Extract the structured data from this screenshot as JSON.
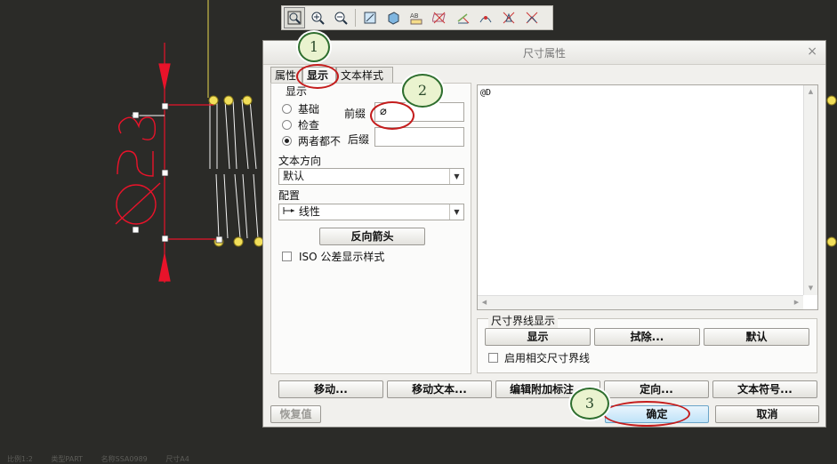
{
  "toolbar": {
    "icons": [
      "zoom-window-icon",
      "zoom-in-icon",
      "zoom-out-icon",
      "refit-icon",
      "shade-icon",
      "annotation-display-icon",
      "datum-plane-off-icon",
      "datum-axis-off-icon",
      "datum-point-off-icon",
      "csys-off-icon",
      "spin-center-off-icon"
    ]
  },
  "dialog": {
    "title": "尺寸属性",
    "close": "×",
    "tabs": [
      "属性",
      "显示",
      "文本样式"
    ],
    "display_group": {
      "legend": "显示",
      "radios": [
        {
          "label": "基础",
          "selected": false
        },
        {
          "label": "检查",
          "selected": false
        },
        {
          "label": "两者都不",
          "selected": true
        }
      ],
      "prefix_label": "前缀",
      "prefix_value": "⌀",
      "suffix_label": "后缀",
      "suffix_value": "",
      "text_direction_label": "文本方向",
      "text_direction_value": "默认",
      "config_label": "配置",
      "config_value": "线性",
      "reverse_arrow_button": "反向箭头",
      "iso_tolerance_label": "ISO 公差显示样式"
    },
    "text_area": {
      "value": "@D"
    },
    "witness_group": {
      "legend": "尺寸界线显示",
      "show_button": "显示",
      "erase_button": "拭除...",
      "default_button": "默认",
      "intersect_label": "启用相交尺寸界线"
    },
    "bottom_buttons": [
      "移动...",
      "移动文本...",
      "编辑附加标注...",
      "定向...",
      "文本符号..."
    ],
    "restore_button": "恢复值",
    "ok_button": "确定",
    "cancel_button": "取消"
  },
  "callouts": [
    "1",
    "2",
    "3"
  ],
  "drawing": {
    "dimension_text": "Ø23"
  },
  "status_bar": [
    "比例1:2",
    "类型PART",
    "名称SSA0989",
    "尺寸A4"
  ],
  "colors": {
    "background": "#2b2b28",
    "dimension": "#e8132a",
    "spring": "#f2df5a",
    "callout_ring": "#c41c1c"
  }
}
